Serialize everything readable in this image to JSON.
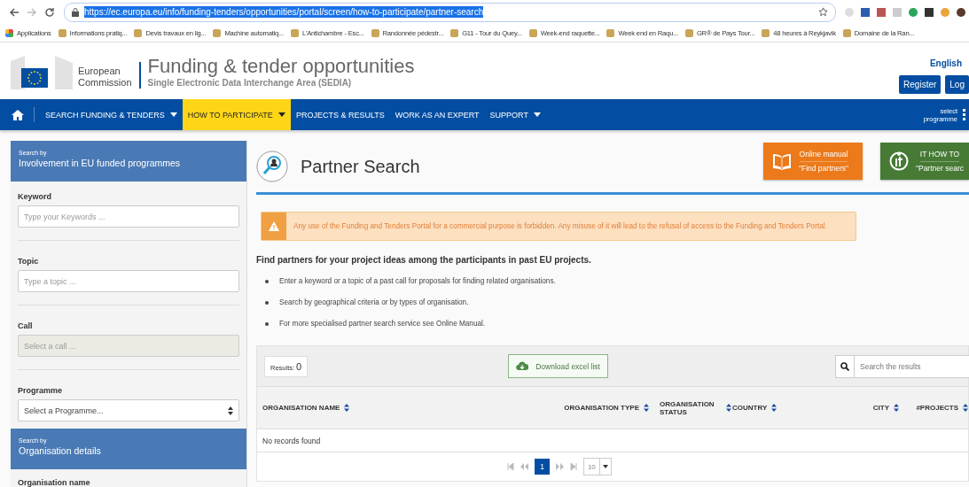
{
  "browser": {
    "url": "https://ec.europa.eu/info/funding-tenders/opportunities/portal/screen/how-to-participate/partner-search",
    "bookmarks": [
      {
        "label": "Applications"
      },
      {
        "label": "Informations pratiq..."
      },
      {
        "label": "Devis travaux en lig..."
      },
      {
        "label": "Machine automatiq..."
      },
      {
        "label": "L'Antichambre - Esc..."
      },
      {
        "label": "Randonnée pédestr..."
      },
      {
        "label": "G11 - Tour du Quey..."
      },
      {
        "label": "Week-end raquette..."
      },
      {
        "label": "Week end en Raqu..."
      },
      {
        "label": "GR® de Pays Tour..."
      },
      {
        "label": "48 heures à Reykjavik"
      },
      {
        "label": "Domaine de la Ran..."
      }
    ]
  },
  "header": {
    "org_lines": [
      "European",
      "Commission"
    ],
    "title": "Funding & tender opportunities",
    "subtitle": "Single Electronic Data Interchange Area (SEDIA)",
    "language": "English",
    "buttons": [
      "Register",
      "Log"
    ]
  },
  "nav": {
    "items": [
      {
        "label": "SEARCH FUNDING & TENDERS",
        "selected": false,
        "dropdown": true
      },
      {
        "label": "HOW TO PARTICIPATE",
        "selected": true,
        "dropdown": true
      },
      {
        "label": "PROJECTS & RESULTS",
        "selected": false,
        "dropdown": false
      },
      {
        "label": "WORK AS AN EXPERT",
        "selected": false,
        "dropdown": false
      },
      {
        "label": "SUPPORT",
        "selected": false,
        "dropdown": true
      }
    ],
    "programme_lines": [
      "select",
      "programme"
    ]
  },
  "sidebar": {
    "sections": [
      {
        "prefix": "Search by",
        "title": "Involvement in EU funded programmes",
        "fields": [
          {
            "label": "Keyword",
            "kind": "text",
            "placeholder": "Type your Keywords ...",
            "disabled": false
          },
          {
            "label": "Topic",
            "kind": "text",
            "placeholder": "Type a topic ...",
            "disabled": false
          },
          {
            "label": "Call",
            "kind": "text",
            "placeholder": "Select a call ...",
            "disabled": true
          },
          {
            "label": "Programme",
            "kind": "select",
            "value": "Select a Programme...",
            "disabled": false
          }
        ]
      },
      {
        "prefix": "Search by",
        "title": "Organisation details",
        "fields": [
          {
            "label": "Organisation name",
            "kind": "label"
          }
        ]
      }
    ]
  },
  "main": {
    "page_title": "Partner Search",
    "help_cards": [
      {
        "kind": "manual",
        "title": "Online manual",
        "subtitle": "\"Find partners\""
      },
      {
        "kind": "it",
        "title": "IT HOW TO",
        "subtitle": "\"Partner searc"
      }
    ],
    "alert": "Any use of the Funding and Tenders Portal for a commercial purpose is forbidden. Any misuse of it will lead to the refusal of access to the Funding and Tenders Portal.",
    "intro": "Find partners for your project ideas among the participants in past EU projects.",
    "bullets": [
      "Enter a keyword or a topic of a past call for proposals for finding related organisations.",
      "Search by geographical criteria or by types of organisation.",
      "For more specialised partner search service see Online Manual."
    ],
    "results_label": "Results:",
    "results_count": "0",
    "download": "Download excel list",
    "search_placeholder": "Search the results",
    "table": {
      "columns": [
        {
          "label": "ORGANISATION NAME"
        },
        {
          "label": "ORGANISATION TYPE"
        },
        {
          "label": "ORGANISATION STATUS"
        },
        {
          "label": "COUNTRY"
        },
        {
          "label": "CITY"
        },
        {
          "label": "#PROJECTS"
        }
      ],
      "empty": "No records found"
    },
    "pagination": {
      "pages": [
        {
          "label": "1",
          "selected": true
        }
      ],
      "page_size": "10"
    }
  }
}
